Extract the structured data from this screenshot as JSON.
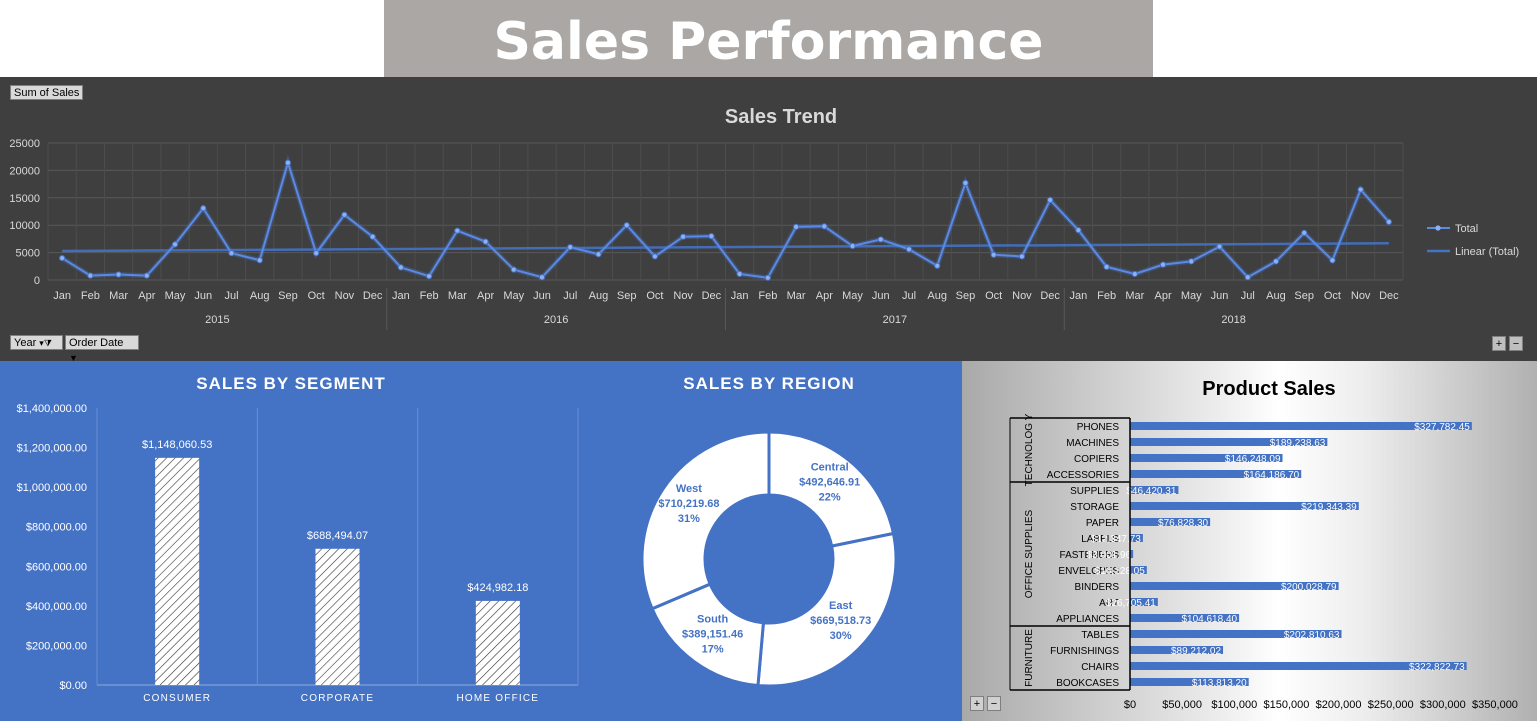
{
  "dashboard": {
    "title": "Sales Performance"
  },
  "trend_controls": {
    "value_field": "Sum of Sales",
    "filter_year": "Year",
    "filter_order_date": "Order Date",
    "expand": "+",
    "collapse": "−"
  },
  "colors": {
    "trend_bg": "#3f3f3f",
    "line": "#4472c4",
    "segment_bg": "#4472c4",
    "bar_blue": "#4472c4"
  },
  "chart_data": [
    {
      "type": "line",
      "title": "Sales Trend",
      "months": [
        "Jan",
        "Feb",
        "Mar",
        "Apr",
        "May",
        "Jun",
        "Jul",
        "Aug",
        "Sep",
        "Oct",
        "Nov",
        "Dec"
      ],
      "years": [
        "2015",
        "2016",
        "2017",
        "2018"
      ],
      "series": [
        {
          "name": "Total",
          "values": [
            4000,
            800,
            1000,
            800,
            6500,
            13100,
            4900,
            3600,
            21400,
            4900,
            11900,
            7900,
            2300,
            700,
            9000,
            7000,
            1900,
            500,
            6000,
            4700,
            10000,
            4300,
            7900,
            8000,
            1100,
            400,
            9700,
            9800,
            6200,
            7400,
            5600,
            2600,
            17700,
            4600,
            4300,
            14600,
            9100,
            2400,
            1100,
            2800,
            3400,
            6100,
            500,
            3400,
            8600,
            3600,
            16500,
            10600
          ]
        },
        {
          "name": "Linear (Total)",
          "values": [
            5300,
            6700
          ]
        }
      ],
      "yticks": [
        0,
        5000,
        10000,
        15000,
        20000,
        25000
      ],
      "ylim": [
        0,
        25000
      ]
    },
    {
      "type": "bar",
      "title": "SALES BY SEGMENT",
      "categories": [
        "CONSUMER",
        "CORPORATE",
        "HOME OFFICE"
      ],
      "values": [
        1148060.53,
        688494.07,
        424982.18
      ],
      "value_labels": [
        "$1,148,060.53",
        "$688,494.07",
        "$424,982.18"
      ],
      "yticks": [
        "$0.00",
        "$200,000.00",
        "$400,000.00",
        "$600,000.00",
        "$800,000.00",
        "$1,000,000.00",
        "$1,200,000.00",
        "$1,400,000.00"
      ],
      "ylim": [
        0,
        1400000
      ]
    },
    {
      "type": "pie",
      "title": "SALES BY REGION",
      "slices": [
        {
          "name": "Central",
          "value": 492646.91,
          "value_label": "$492,646.91",
          "pct": "22%"
        },
        {
          "name": "East",
          "value": 669518.73,
          "value_label": "$669,518.73",
          "pct": "30%"
        },
        {
          "name": "South",
          "value": 389151.46,
          "value_label": "$389,151.46",
          "pct": "17%"
        },
        {
          "name": "West",
          "value": 710219.68,
          "value_label": "$710,219.68",
          "pct": "31%"
        }
      ]
    },
    {
      "type": "bar",
      "title": "Product Sales",
      "groups": [
        {
          "name": "TECHNOLOG\nY",
          "items": [
            {
              "label": "PHONES",
              "value": 327782.45,
              "value_label": "$327,782.45"
            },
            {
              "label": "MACHINES",
              "value": 189238.63,
              "value_label": "$189,238.63"
            },
            {
              "label": "COPIERS",
              "value": 146248.09,
              "value_label": "$146,248.09"
            },
            {
              "label": "ACCESSORIES",
              "value": 164186.7,
              "value_label": "$164,186.70"
            }
          ]
        },
        {
          "name": "OFFICE SUPPLIES",
          "items": [
            {
              "label": "SUPPLIES",
              "value": 46420.31,
              "value_label": "$46,420.31"
            },
            {
              "label": "STORAGE",
              "value": 219343.39,
              "value_label": "$219,343.39"
            },
            {
              "label": "PAPER",
              "value": 76828.3,
              "value_label": "$76,828.30"
            },
            {
              "label": "LABELS",
              "value": 12347.73,
              "value_label": "$12,347.73"
            },
            {
              "label": "FASTENERS",
              "value": 3001.96,
              "value_label": "$3,001.96"
            },
            {
              "label": "ENVELOPES",
              "value": 16128.05,
              "value_label": "$16,128.05"
            },
            {
              "label": "BINDERS",
              "value": 200028.79,
              "value_label": "$200,028.79"
            },
            {
              "label": "ART",
              "value": 26705.41,
              "value_label": "$26,705.41"
            },
            {
              "label": "APPLIANCES",
              "value": 104618.4,
              "value_label": "$104,618.40"
            }
          ]
        },
        {
          "name": "FURNITURE",
          "items": [
            {
              "label": "TABLES",
              "value": 202810.63,
              "value_label": "$202,810.63"
            },
            {
              "label": "FURNISHINGS",
              "value": 89212.02,
              "value_label": "$89,212.02"
            },
            {
              "label": "CHAIRS",
              "value": 322822.73,
              "value_label": "$322,822.73"
            },
            {
              "label": "BOOKCASES",
              "value": 113813.2,
              "value_label": "$113,813.20"
            }
          ]
        }
      ],
      "xticks": [
        "$0",
        "$50,000",
        "$100,000",
        "$150,000",
        "$200,000",
        "$250,000",
        "$300,000",
        "$350,000"
      ],
      "xlim": [
        0,
        350000
      ]
    }
  ]
}
